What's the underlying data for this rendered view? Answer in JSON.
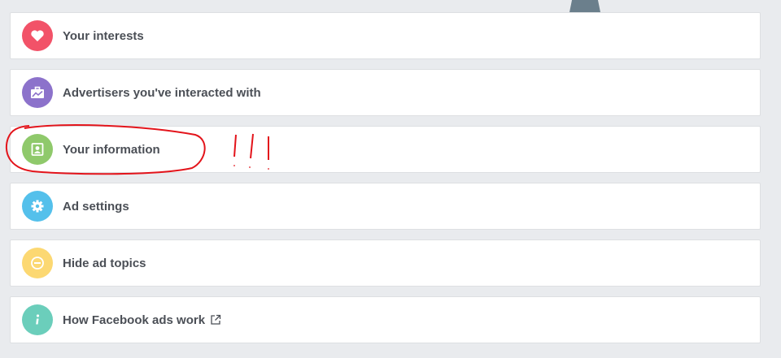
{
  "items": [
    {
      "label": "Your interests",
      "icon": "heart-icon",
      "color": "#f25268"
    },
    {
      "label": "Advertisers you've interacted with",
      "icon": "briefcase-icon",
      "color": "#8c72cb"
    },
    {
      "label": "Your information",
      "icon": "id-card-icon",
      "color": "#8fc96b"
    },
    {
      "label": "Ad settings",
      "icon": "gear-icon",
      "color": "#54c0eb"
    },
    {
      "label": "Hide ad topics",
      "icon": "minus-icon",
      "color": "#fcd872"
    },
    {
      "label": "How Facebook ads work",
      "icon": "info-icon",
      "color": "#6bcebb",
      "trailing_icon": "external-link-icon"
    }
  ],
  "annotation": {
    "color": "#e3141b",
    "type": "hand-drawn circle and exclamation marks"
  }
}
